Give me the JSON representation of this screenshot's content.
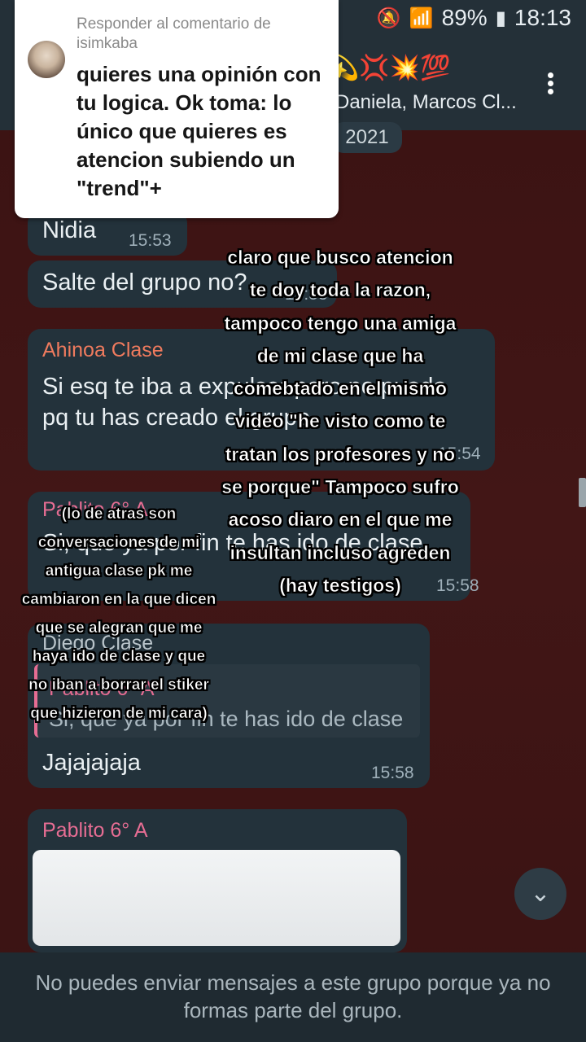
{
  "status_bar": {
    "battery": "89%",
    "time": "18:13"
  },
  "header": {
    "members": "Daniela, Marcos Cl...",
    "emojis": "💫💢💥💯"
  },
  "date_chip": "2021",
  "reply": {
    "header": "Responder al comentario de isimkaba",
    "text": "quieres una opinión con tu logica. Ok toma: lo único que quieres es atencion subiendo un \"trend\"+"
  },
  "messages": [
    {
      "text": "Nidia",
      "time": "15:53"
    },
    {
      "text": "Salte del grupo no?",
      "time": "15:53"
    },
    {
      "name": "Ahinoa Clase",
      "text": "Si esq te iba a expulsar pero no puedo pq tu has creado el grupo",
      "time": "15:54"
    },
    {
      "name": "Pablito 6° A",
      "text": "Si, que ya por fin te has ido de clase",
      "time": "15:58"
    },
    {
      "name": "Diego Clase",
      "quote_name": "Pablito 6° A",
      "quote_text": "Si, que ya por fin te has ido de clase",
      "text": "Jajajajaja",
      "time": "15:58"
    },
    {
      "name": "Pablito 6° A"
    }
  ],
  "overlay_right": "claro que busco atencion te doy toda la razon, tampoco tengo una amiga de mi clase que ha comebtado en el mismo video \"he visto como te tratan los profesores y no se porque\" Tampoco sufro acoso diaro en el que me insultan incluso agreden (hay testigos)",
  "overlay_left": "(lo de atras son conversaciones de mi antigua clase pk me cambiaron en la que dicen que se alegran que me haya ido de clase y que no iban a borrar el stiker que hizieron de mi cara)",
  "footer": "No puedes enviar mensajes a este grupo porque ya no formas parte del grupo.",
  "colors": {
    "chat_bg": "#3d1414",
    "bubble": "#23323b",
    "name_orange": "#f07b5e",
    "name_pink": "#e66d93"
  }
}
